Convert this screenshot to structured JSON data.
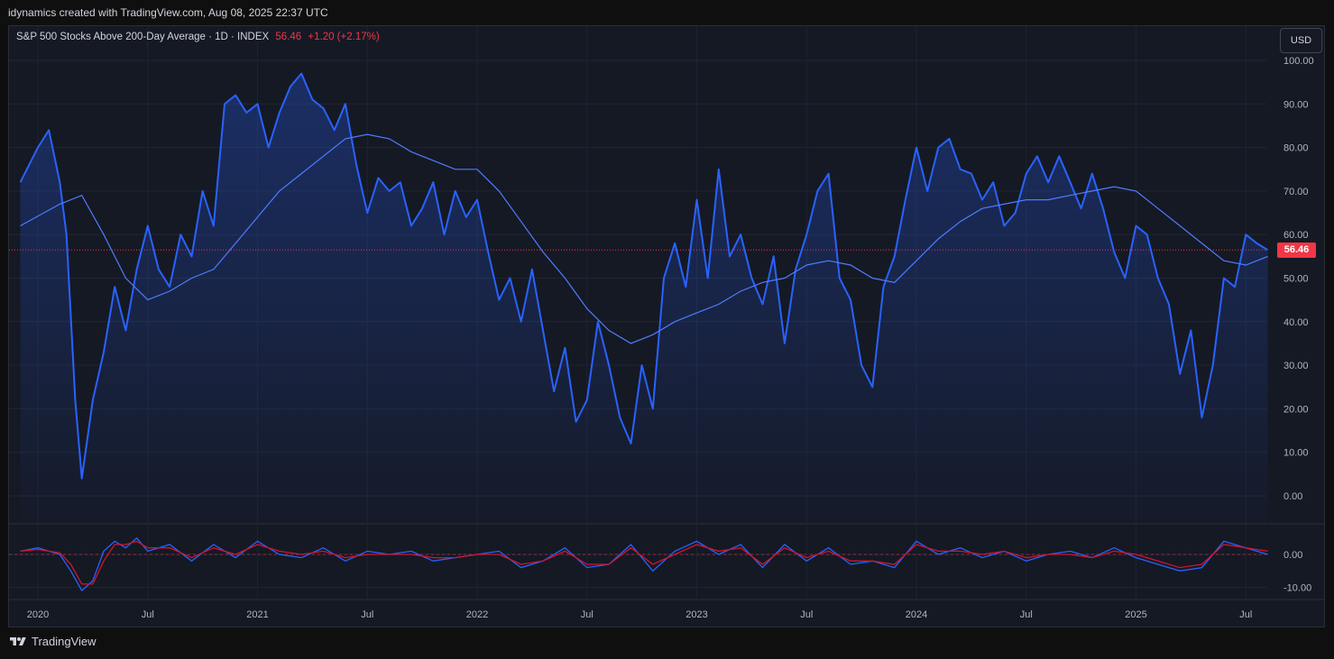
{
  "header": {
    "credit": "idynamics created with TradingView.com, Aug 08, 2025 22:37 UTC"
  },
  "legend": {
    "symbol": "S&P 500 Stocks Above 200-Day Average · 1D · INDEX",
    "last": "56.46",
    "change": "+1.20 (+2.17%)"
  },
  "currency_button": "USD",
  "price_tag": "56.46",
  "footer": {
    "brand": "TradingView"
  },
  "colors": {
    "line": "#2962ff",
    "ma": "#4f7cff",
    "osc_red": "#d1152a",
    "price_tag": "#f23645"
  },
  "chart_data": [
    {
      "type": "area",
      "title": "S&P 500 Stocks Above 200-Day Average · 1D · INDEX",
      "x_tick_labels": [
        "2020",
        "Jul",
        "2021",
        "Jul",
        "2022",
        "Jul",
        "2023",
        "Jul",
        "2024",
        "Jul",
        "2025",
        "Jul"
      ],
      "y_tick_labels": [
        "100.00",
        "90.00",
        "80.00",
        "70.00",
        "60.00",
        "50.00",
        "40.00",
        "30.00",
        "20.00",
        "10.00",
        "0.00"
      ],
      "ylim": [
        0,
        100
      ],
      "last_value": 56.46,
      "series": [
        {
          "x": [
            2019.92,
            2020.0,
            2020.05,
            2020.1,
            2020.13,
            2020.17,
            2020.2,
            2020.25,
            2020.3,
            2020.35,
            2020.4,
            2020.45,
            2020.5,
            2020.55,
            2020.6,
            2020.65,
            2020.7,
            2020.75,
            2020.8,
            2020.85,
            2020.9,
            2020.95,
            2021.0,
            2021.05,
            2021.1,
            2021.15,
            2021.2,
            2021.25,
            2021.3,
            2021.35,
            2021.4,
            2021.45,
            2021.5,
            2021.55,
            2021.6,
            2021.65,
            2021.7,
            2021.75,
            2021.8,
            2021.85,
            2021.9,
            2021.95,
            2022.0,
            2022.05,
            2022.1,
            2022.15,
            2022.2,
            2022.25,
            2022.3,
            2022.35,
            2022.4,
            2022.45,
            2022.5,
            2022.55,
            2022.6,
            2022.65,
            2022.7,
            2022.75,
            2022.8,
            2022.85,
            2022.9,
            2022.95,
            2023.0,
            2023.05,
            2023.1,
            2023.15,
            2023.2,
            2023.25,
            2023.3,
            2023.35,
            2023.4,
            2023.45,
            2023.5,
            2023.55,
            2023.6,
            2023.65,
            2023.7,
            2023.75,
            2023.8,
            2023.85,
            2023.9,
            2023.95,
            2024.0,
            2024.05,
            2024.1,
            2024.15,
            2024.2,
            2024.25,
            2024.3,
            2024.35,
            2024.4,
            2024.45,
            2024.5,
            2024.55,
            2024.6,
            2024.65,
            2024.7,
            2024.75,
            2024.8,
            2024.85,
            2024.9,
            2024.95,
            2025.0,
            2025.05,
            2025.1,
            2025.15,
            2025.2,
            2025.25,
            2025.3,
            2025.35,
            2025.4,
            2025.45,
            2025.5,
            2025.55,
            2025.6
          ],
          "values": [
            72,
            80,
            84,
            72,
            60,
            22,
            4,
            22,
            33,
            48,
            38,
            52,
            62,
            52,
            48,
            60,
            55,
            70,
            62,
            90,
            92,
            88,
            90,
            80,
            88,
            94,
            97,
            91,
            89,
            84,
            90,
            76,
            65,
            73,
            70,
            72,
            62,
            66,
            72,
            60,
            70,
            64,
            68,
            56,
            45,
            50,
            40,
            52,
            38,
            24,
            34,
            17,
            22,
            40,
            30,
            18,
            12,
            30,
            20,
            50,
            58,
            48,
            68,
            50,
            75,
            55,
            60,
            50,
            44,
            55,
            35,
            52,
            60,
            70,
            74,
            50,
            45,
            30,
            25,
            48,
            55,
            68,
            80,
            70,
            80,
            82,
            75,
            74,
            68,
            72,
            62,
            65,
            74,
            78,
            72,
            78,
            72,
            66,
            74,
            66,
            56,
            50,
            62,
            60,
            50,
            44,
            28,
            38,
            18,
            30,
            50,
            48,
            60,
            58,
            56.46
          ]
        },
        {
          "name": "",
          "x": [
            2019.92,
            2020.1,
            2020.2,
            2020.3,
            2020.4,
            2020.5,
            2020.6,
            2020.7,
            2020.8,
            2020.9,
            2021.0,
            2021.1,
            2021.2,
            2021.3,
            2021.4,
            2021.5,
            2021.6,
            2021.7,
            2021.8,
            2021.9,
            2022.0,
            2022.1,
            2022.2,
            2022.3,
            2022.4,
            2022.5,
            2022.6,
            2022.7,
            2022.8,
            2022.9,
            2023.0,
            2023.1,
            2023.2,
            2023.3,
            2023.4,
            2023.5,
            2023.6,
            2023.7,
            2023.8,
            2023.9,
            2024.0,
            2024.1,
            2024.2,
            2024.3,
            2024.4,
            2024.5,
            2024.6,
            2024.7,
            2024.8,
            2024.9,
            2025.0,
            2025.1,
            2025.2,
            2025.3,
            2025.4,
            2025.5,
            2025.6
          ],
          "values": [
            62,
            67,
            69,
            60,
            50,
            45,
            47,
            50,
            52,
            58,
            64,
            70,
            74,
            78,
            82,
            83,
            82,
            79,
            77,
            75,
            75,
            70,
            63,
            56,
            50,
            43,
            38,
            35,
            37,
            40,
            42,
            44,
            47,
            49,
            50,
            53,
            54,
            53,
            50,
            49,
            54,
            59,
            63,
            66,
            67,
            68,
            68,
            69,
            70,
            71,
            70,
            66,
            62,
            58,
            54,
            53,
            55
          ]
        }
      ]
    },
    {
      "type": "line",
      "y_tick_labels": [
        "0.00",
        "-10.00"
      ],
      "ylim": [
        -13,
        7
      ],
      "series": [
        {
          "name": "",
          "x": [
            2019.92,
            2020.0,
            2020.1,
            2020.15,
            2020.2,
            2020.25,
            2020.3,
            2020.35,
            2020.4,
            2020.45,
            2020.5,
            2020.6,
            2020.7,
            2020.8,
            2020.9,
            2021.0,
            2021.1,
            2021.2,
            2021.3,
            2021.4,
            2021.5,
            2021.6,
            2021.7,
            2021.8,
            2021.9,
            2022.0,
            2022.1,
            2022.2,
            2022.3,
            2022.4,
            2022.5,
            2022.6,
            2022.7,
            2022.8,
            2022.9,
            2023.0,
            2023.1,
            2023.2,
            2023.3,
            2023.4,
            2023.5,
            2023.6,
            2023.7,
            2023.8,
            2023.9,
            2024.0,
            2024.1,
            2024.2,
            2024.3,
            2024.4,
            2024.5,
            2024.6,
            2024.7,
            2024.8,
            2024.9,
            2025.0,
            2025.1,
            2025.2,
            2025.3,
            2025.4,
            2025.5,
            2025.6
          ],
          "values": [
            1,
            2,
            0,
            -5,
            -11,
            -8,
            1,
            4,
            2,
            5,
            1,
            3,
            -2,
            3,
            -1,
            4,
            0,
            -1,
            2,
            -2,
            1,
            0,
            1,
            -2,
            -1,
            0,
            1,
            -4,
            -2,
            2,
            -4,
            -3,
            3,
            -5,
            1,
            4,
            0,
            3,
            -4,
            3,
            -2,
            2,
            -3,
            -2,
            -4,
            4,
            0,
            2,
            -1,
            1,
            -2,
            0,
            1,
            -1,
            2,
            -1,
            -3,
            -5,
            -4,
            4,
            2,
            0
          ]
        },
        {
          "name": "",
          "x": [
            2019.92,
            2020.0,
            2020.1,
            2020.15,
            2020.2,
            2020.25,
            2020.3,
            2020.35,
            2020.4,
            2020.45,
            2020.5,
            2020.6,
            2020.7,
            2020.8,
            2020.9,
            2021.0,
            2021.1,
            2021.2,
            2021.3,
            2021.4,
            2021.5,
            2021.6,
            2021.7,
            2021.8,
            2021.9,
            2022.0,
            2022.1,
            2022.2,
            2022.3,
            2022.4,
            2022.5,
            2022.6,
            2022.7,
            2022.8,
            2022.9,
            2023.0,
            2023.1,
            2023.2,
            2023.3,
            2023.4,
            2023.5,
            2023.6,
            2023.7,
            2023.8,
            2023.9,
            2024.0,
            2024.1,
            2024.2,
            2024.3,
            2024.4,
            2024.5,
            2024.6,
            2024.7,
            2024.8,
            2024.9,
            2025.0,
            2025.1,
            2025.2,
            2025.3,
            2025.4,
            2025.5,
            2025.6
          ],
          "values": [
            1,
            1.5,
            0.5,
            -3,
            -9,
            -9,
            -2,
            3,
            3,
            4,
            2,
            2,
            -1,
            2,
            0,
            3,
            1,
            0,
            1,
            -1,
            0,
            0,
            0,
            -1,
            -1,
            0,
            0,
            -3,
            -2,
            1,
            -3,
            -3,
            2,
            -3,
            0,
            3,
            1,
            2,
            -3,
            2,
            -1,
            1,
            -2,
            -2,
            -3,
            3,
            1,
            1,
            0,
            1,
            -1,
            0,
            0,
            -1,
            1,
            0,
            -2,
            -4,
            -3,
            3,
            2,
            1
          ]
        }
      ]
    }
  ]
}
